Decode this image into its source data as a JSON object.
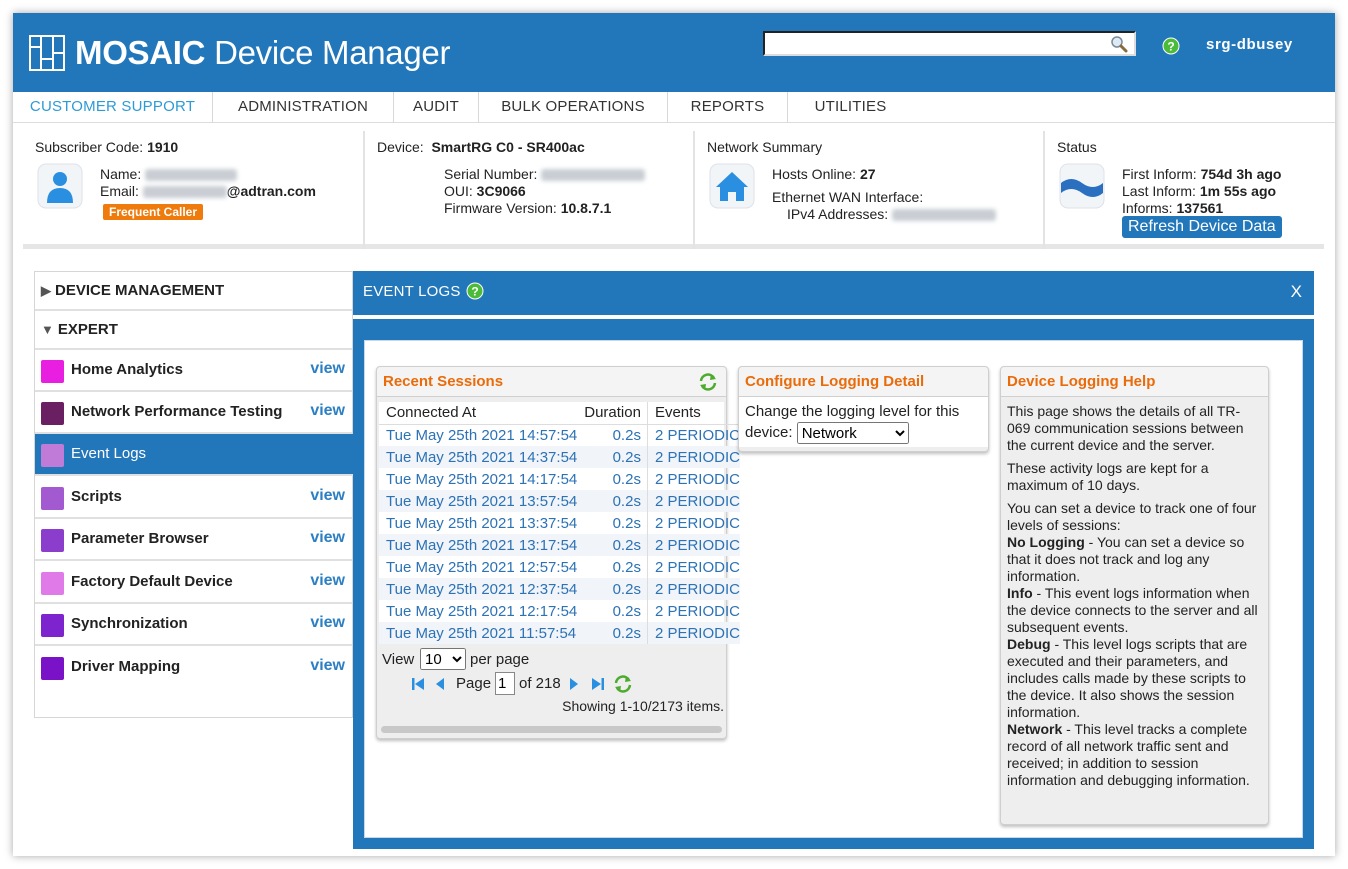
{
  "app": {
    "brand_bold": "MOSAIC",
    "brand_rest": " Device Manager",
    "search": {
      "value": "",
      "placeholder": ""
    },
    "username": "srg-dbusey"
  },
  "nav": {
    "items": [
      {
        "label": "CUSTOMER SUPPORT",
        "active": true
      },
      {
        "label": "ADMINISTRATION"
      },
      {
        "label": "AUDIT"
      },
      {
        "label": "BULK OPERATIONS"
      },
      {
        "label": "REPORTS"
      },
      {
        "label": "UTILITIES"
      }
    ]
  },
  "subscriber": {
    "code_label": "Subscriber Code:",
    "code": "1910",
    "name_label": "Name:",
    "email_label": "Email:",
    "email_domain": "@adtran.com",
    "badge": "Frequent Caller"
  },
  "device": {
    "label": "Device:",
    "model": "SmartRG C0 - SR400ac",
    "serial_label": "Serial Number:",
    "oui_label": "OUI:",
    "oui": "3C9066",
    "firmware_label": "Firmware Version:",
    "firmware": "10.8.7.1"
  },
  "network": {
    "title": "Network Summary",
    "hosts_label": "Hosts Online:",
    "hosts": "27",
    "wan_label": "Ethernet WAN Interface:",
    "ipv4_label": "IPv4 Addresses:"
  },
  "status": {
    "title": "Status",
    "first_label": "First Inform:",
    "first": "754d 3h ago",
    "last_label": "Last Inform:",
    "last": "1m 55s ago",
    "informs_label": "Informs:",
    "informs": "137561",
    "refresh_label": "Refresh Device Data"
  },
  "sidebar": {
    "device_management": "DEVICE MANAGEMENT",
    "expert": "EXPERT",
    "view_label": "view",
    "items": [
      {
        "label": "Home Analytics",
        "color": "#e81ee0"
      },
      {
        "label": "Network Performance Testing",
        "color": "#6a1f63"
      },
      {
        "label": "Event Logs",
        "color": "#c07ad8",
        "active": true
      },
      {
        "label": "Scripts",
        "color": "#a35ad0"
      },
      {
        "label": "Parameter Browser",
        "color": "#8b3dcc"
      },
      {
        "label": "Factory Default Device",
        "color": "#e07ae8"
      },
      {
        "label": "Synchronization",
        "color": "#7e24cf"
      },
      {
        "label": "Driver Mapping",
        "color": "#7a12c8"
      }
    ]
  },
  "event_logs": {
    "title": "EVENT LOGS",
    "close": "X",
    "recent": {
      "title": "Recent Sessions",
      "columns": [
        "Connected At",
        "Duration",
        "Events"
      ],
      "rows": [
        [
          "Tue May 25th 2021 14:57:54",
          "0.2s",
          "2 PERIODIC"
        ],
        [
          "Tue May 25th 2021 14:37:54",
          "0.2s",
          "2 PERIODIC"
        ],
        [
          "Tue May 25th 2021 14:17:54",
          "0.2s",
          "2 PERIODIC"
        ],
        [
          "Tue May 25th 2021 13:57:54",
          "0.2s",
          "2 PERIODIC"
        ],
        [
          "Tue May 25th 2021 13:37:54",
          "0.2s",
          "2 PERIODIC"
        ],
        [
          "Tue May 25th 2021 13:17:54",
          "0.2s",
          "2 PERIODIC"
        ],
        [
          "Tue May 25th 2021 12:57:54",
          "0.2s",
          "2 PERIODIC"
        ],
        [
          "Tue May 25th 2021 12:37:54",
          "0.2s",
          "2 PERIODIC"
        ],
        [
          "Tue May 25th 2021 12:17:54",
          "0.2s",
          "2 PERIODIC"
        ],
        [
          "Tue May 25th 2021 11:57:54",
          "0.2s",
          "2 PERIODIC"
        ]
      ],
      "view_label": "View",
      "per_page_value": "10",
      "per_page_label": "per page",
      "page_label": "Page",
      "page_value": "1",
      "of_label": "of 218",
      "showing": "Showing 1-10/2173 items."
    },
    "configure": {
      "title": "Configure Logging Detail",
      "text1": "Change the logging level for this",
      "text2": "device:",
      "level": "Network"
    },
    "help": {
      "title": "Device Logging Help",
      "p1": "This page shows the details of all TR-069 communication sessions between the current device and the server.",
      "p2": "These activity logs are kept for a maximum of 10 days.",
      "p3": "You can set a device to track one of four levels of sessions:",
      "l1_term": "No Logging",
      "l1_text": " - You can set a device so that it does not track and log any information.",
      "l2_term": "Info",
      "l2_text": " - This event logs information when the device connects to the server and all subsequent events.",
      "l3_term": "Debug",
      "l3_text": " - This level logs scripts that are executed and their parameters, and includes calls made by these scripts to the device. It also shows the session information.",
      "l4_term": "Network",
      "l4_text": " - This level tracks a complete record of all network traffic sent and received; in addition to session information and debugging information."
    }
  }
}
